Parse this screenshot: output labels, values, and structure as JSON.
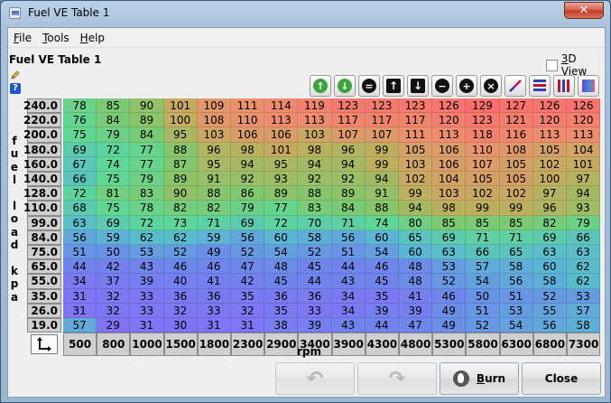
{
  "window": {
    "title": "Fuel VE Table 1",
    "close_glyph": "✕"
  },
  "menu": [
    {
      "label": "File",
      "mnemonic": "F",
      "rest": "ile"
    },
    {
      "label": "Tools",
      "mnemonic": "T",
      "rest": "ools"
    },
    {
      "label": "Help",
      "mnemonic": "H",
      "rest": "elp"
    }
  ],
  "panel": {
    "title": "Fuel VE Table 1",
    "view3d_label": "3D View",
    "view3d_mnemonic": "3",
    "view3d_rest": "D View",
    "view3d_checked": false
  },
  "toolbar": [
    {
      "name": "increment-green-icon",
      "kind": "circle",
      "color": "#3da33d",
      "glyph": "↑"
    },
    {
      "name": "decrement-green-icon",
      "kind": "circle",
      "color": "#3da33d",
      "glyph": "↓"
    },
    {
      "name": "set-equal-icon",
      "kind": "circle",
      "color": "#111111",
      "glyph": "="
    },
    {
      "name": "arrow-up-icon",
      "kind": "square",
      "color": "#111111",
      "glyph": "↑"
    },
    {
      "name": "arrow-down-icon",
      "kind": "square",
      "color": "#111111",
      "glyph": "↓"
    },
    {
      "name": "minus-icon",
      "kind": "circle",
      "color": "#111111",
      "glyph": "−"
    },
    {
      "name": "plus-icon",
      "kind": "circle",
      "color": "#111111",
      "glyph": "+"
    },
    {
      "name": "multiply-icon",
      "kind": "circle",
      "color": "#111111",
      "glyph": "×"
    },
    {
      "name": "interpolate-icon",
      "kind": "line",
      "color": "#c0184a",
      "glyph": ""
    },
    {
      "name": "horizontal-interpolate-icon",
      "kind": "hbars",
      "color": "#2d3fb5",
      "glyph": ""
    },
    {
      "name": "vertical-interpolate-icon",
      "kind": "vbars",
      "color": "#b5182d",
      "glyph": ""
    },
    {
      "name": "color-gradient-icon",
      "kind": "gradient",
      "color": "#2d8fd5",
      "glyph": ""
    }
  ],
  "y_axis_label": [
    "f",
    "u",
    "e",
    "l",
    "",
    "l",
    "o",
    "a",
    "d",
    "",
    "k",
    "p",
    "a"
  ],
  "y_bins": [
    "240.0",
    "220.0",
    "200.0",
    "180.0",
    "160.0",
    "140.0",
    "128.0",
    "110.0",
    "99.0",
    "84.0",
    "75.0",
    "65.0",
    "55.0",
    "35.0",
    "26.0",
    "19.0"
  ],
  "x_axis_label": "rpm",
  "x_bins": [
    "500",
    "800",
    "1000",
    "1500",
    "1800",
    "2300",
    "2900",
    "3400",
    "3900",
    "4300",
    "4800",
    "5300",
    "5800",
    "6300",
    "6800",
    "7300"
  ],
  "ve_table": [
    [
      78,
      85,
      90,
      101,
      109,
      111,
      114,
      119,
      123,
      123,
      123,
      126,
      129,
      127,
      126,
      126
    ],
    [
      76,
      84,
      89,
      100,
      108,
      110,
      113,
      113,
      117,
      117,
      117,
      120,
      123,
      121,
      120,
      120
    ],
    [
      75,
      79,
      84,
      95,
      103,
      106,
      106,
      103,
      107,
      107,
      111,
      113,
      118,
      116,
      113,
      113
    ],
    [
      69,
      72,
      77,
      88,
      96,
      98,
      101,
      98,
      96,
      99,
      105,
      106,
      110,
      108,
      105,
      104
    ],
    [
      67,
      74,
      77,
      87,
      95,
      94,
      95,
      94,
      94,
      99,
      103,
      106,
      107,
      105,
      102,
      101
    ],
    [
      66,
      75,
      79,
      89,
      91,
      92,
      93,
      92,
      92,
      94,
      102,
      104,
      105,
      105,
      100,
      97
    ],
    [
      72,
      81,
      83,
      90,
      88,
      86,
      89,
      88,
      89,
      91,
      99,
      103,
      102,
      102,
      97,
      94
    ],
    [
      68,
      75,
      78,
      82,
      82,
      79,
      77,
      83,
      84,
      88,
      94,
      98,
      99,
      99,
      96,
      93
    ],
    [
      63,
      69,
      72,
      73,
      71,
      69,
      72,
      70,
      71,
      74,
      80,
      85,
      85,
      85,
      82,
      79
    ],
    [
      56,
      59,
      62,
      62,
      59,
      56,
      60,
      58,
      56,
      60,
      65,
      69,
      71,
      71,
      69,
      66
    ],
    [
      51,
      50,
      53,
      52,
      49,
      52,
      54,
      52,
      51,
      54,
      60,
      63,
      66,
      65,
      63,
      63
    ],
    [
      44,
      42,
      43,
      46,
      46,
      47,
      48,
      45,
      44,
      46,
      48,
      53,
      57,
      58,
      60,
      62
    ],
    [
      34,
      37,
      39,
      40,
      41,
      42,
      45,
      44,
      43,
      45,
      48,
      52,
      54,
      56,
      58,
      62
    ],
    [
      31,
      32,
      33,
      36,
      36,
      35,
      36,
      36,
      34,
      35,
      41,
      46,
      50,
      51,
      52,
      53
    ],
    [
      31,
      32,
      33,
      32,
      33,
      32,
      35,
      33,
      34,
      39,
      39,
      49,
      51,
      53,
      55,
      57
    ],
    [
      57,
      29,
      31,
      30,
      31,
      31,
      38,
      39,
      43,
      44,
      47,
      49,
      52,
      54,
      56,
      58
    ]
  ],
  "buttons": {
    "undo_glyph": "↶",
    "redo_glyph": "↷",
    "burn_label": "Burn",
    "burn_mnemonic": "B",
    "burn_rest": "urn",
    "close_label": "Close"
  }
}
